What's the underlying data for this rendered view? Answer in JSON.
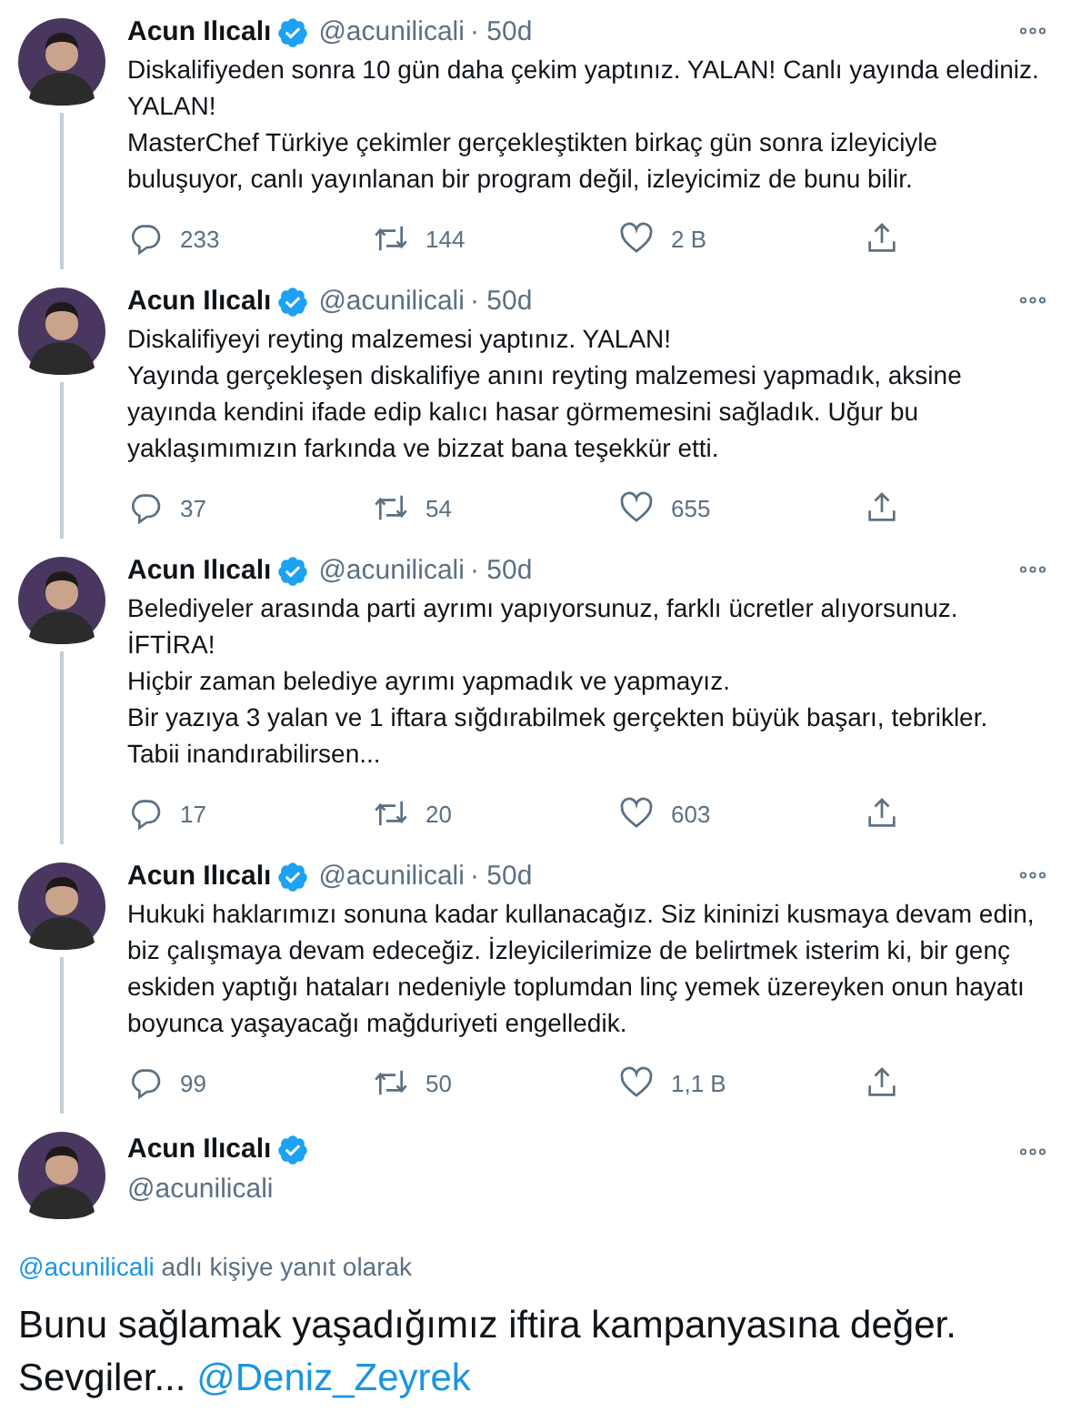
{
  "thread": [
    {
      "name": "Acun Ilıcalı",
      "verified": true,
      "handle": "@acunilicali",
      "time": "· 50d",
      "text": "Diskalifiyeden sonra 10 gün daha çekim yaptınız. YALAN! Canlı yayında elediniz. YALAN!\nMasterChef Türkiye çekimler gerçekleştikten birkaç gün sonra izleyiciyle buluşuyor, canlı yayınlanan bir program değil, izleyicimiz de bunu bilir.",
      "replies": "233",
      "retweets": "144",
      "likes": "2 B"
    },
    {
      "name": "Acun Ilıcalı",
      "verified": true,
      "handle": "@acunilicali",
      "time": "· 50d",
      "text": "Diskalifiyeyi reyting malzemesi yaptınız. YALAN!\nYayında gerçekleşen diskalifiye anını reyting malzemesi yapmadık, aksine yayında kendini ifade edip kalıcı hasar görmemesini sağladık. Uğur bu yaklaşımımızın farkında ve bizzat bana teşekkür etti.",
      "replies": "37",
      "retweets": "54",
      "likes": "655"
    },
    {
      "name": "Acun Ilıcalı",
      "verified": true,
      "handle": "@acunilicali",
      "time": "· 50d",
      "text": "Belediyeler arasında parti ayrımı yapıyorsunuz, farklı ücretler alıyorsunuz.\nİFTİRA!\nHiçbir zaman belediye ayrımı yapmadık ve yapmayız.\nBir yazıya 3 yalan ve 1 iftara sığdırabilmek gerçekten büyük başarı, tebrikler.\nTabii inandırabilirsen...",
      "replies": "17",
      "retweets": "20",
      "likes": "603"
    },
    {
      "name": "Acun Ilıcalı",
      "verified": true,
      "handle": "@acunilicali",
      "time": "· 50d",
      "text": "Hukuki haklarımızı sonuna kadar kullanacağız. Siz kininizi kusmaya devam edin, biz çalışmaya devam edeceğiz. İzleyicilerimize de belirtmek isterim ki, bir genç eskiden yaptığı hataları nedeniyle toplumdan linç yemek üzereyken onun hayatı boyunca yaşayacağı mağduriyeti engelledik.",
      "replies": "99",
      "retweets": "50",
      "likes": "1,1 B"
    }
  ],
  "main_tweet": {
    "name": "Acun Ilıcalı",
    "verified": true,
    "handle": "@acunilicali",
    "reply_to": {
      "mention": "@acunilicali",
      "text": "adlı kişiye yanıt olarak"
    },
    "text": "Bunu sağlamak yaşadığımız iftira kampanyasına değer.\nSevgiler...",
    "mention": "@Deniz_Zeyrek"
  }
}
